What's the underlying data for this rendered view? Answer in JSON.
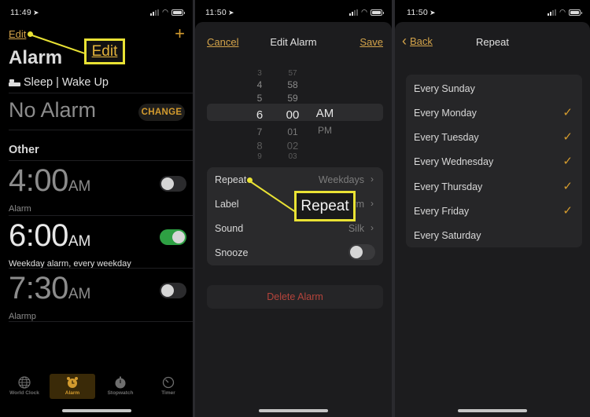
{
  "screens": [
    {
      "status_time": "11:49",
      "edit_label": "Edit",
      "add_label": "+",
      "title": "Alarm",
      "sleep_label": "Sleep | Wake Up",
      "no_alarm": "No Alarm",
      "change_label": "CHANGE",
      "other_heading": "Other",
      "alarms": [
        {
          "time": "4:00",
          "ampm": "AM",
          "label": "Alarm",
          "enabled": false
        },
        {
          "time": "6:00",
          "ampm": "AM",
          "label": "Weekday alarm, every weekday",
          "enabled": true
        },
        {
          "time": "7:30",
          "ampm": "AM",
          "label": "Alarmp",
          "enabled": false
        }
      ],
      "tabs": [
        {
          "label": "World Clock",
          "icon": "globe-icon",
          "active": false
        },
        {
          "label": "Alarm",
          "icon": "alarm-clock-icon",
          "active": true
        },
        {
          "label": "Stopwatch",
          "icon": "stopwatch-icon",
          "active": false
        },
        {
          "label": "Timer",
          "icon": "timer-icon",
          "active": false
        }
      ],
      "callout": "Edit"
    },
    {
      "status_time": "11:50",
      "cancel_label": "Cancel",
      "title": "Edit Alarm",
      "save_label": "Save",
      "picker": {
        "hours": [
          "3",
          "4",
          "5",
          "6",
          "7",
          "8",
          "9"
        ],
        "minutes": [
          "57",
          "58",
          "59",
          "00",
          "01",
          "02",
          "03"
        ],
        "periods": [
          "AM",
          "PM"
        ],
        "selected": {
          "hour": "6",
          "minute": "00",
          "period": "AM"
        }
      },
      "settings": [
        {
          "label": "Repeat",
          "value": "Weekdays",
          "chevron": true
        },
        {
          "label": "Label",
          "value": "Alarm",
          "chevron": true
        },
        {
          "label": "Sound",
          "value": "Silk",
          "chevron": true
        },
        {
          "label": "Snooze",
          "value": "",
          "toggle": false
        }
      ],
      "delete_label": "Delete Alarm",
      "callout": "Repeat"
    },
    {
      "status_time": "11:50",
      "back_label": "Back",
      "title": "Repeat",
      "days": [
        {
          "label": "Every Sunday",
          "checked": false
        },
        {
          "label": "Every Monday",
          "checked": true
        },
        {
          "label": "Every Tuesday",
          "checked": true
        },
        {
          "label": "Every Wednesday",
          "checked": true
        },
        {
          "label": "Every Thursday",
          "checked": true
        },
        {
          "label": "Every Friday",
          "checked": true
        },
        {
          "label": "Every Saturday",
          "checked": false
        }
      ],
      "check_glyph": "✓"
    }
  ],
  "colors": {
    "accent": "#d39b2e",
    "toggle_on": "#2ea043",
    "destructive": "#b5443b",
    "callout": "#e9e234"
  }
}
